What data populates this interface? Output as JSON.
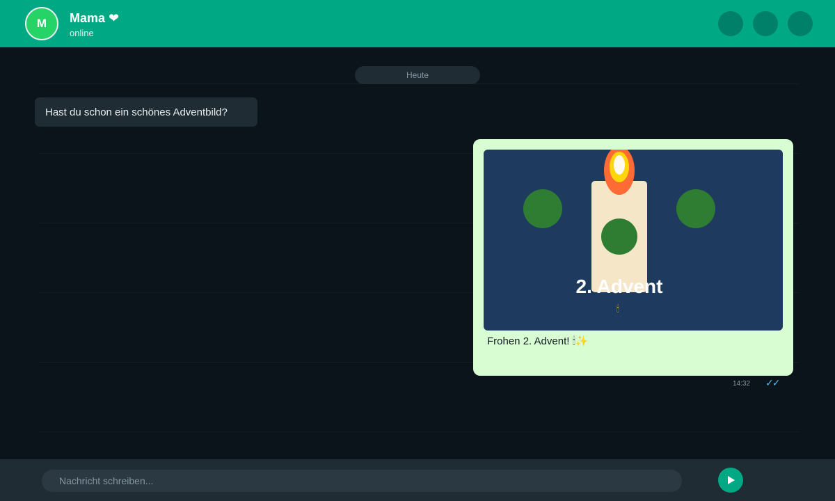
{
  "header": {
    "avatar_initial": "M",
    "contact_name": "Mama ❤",
    "status": "online",
    "action_buttons": [
      "header-action-1",
      "header-action-2",
      "header-action-3"
    ]
  },
  "chat": {
    "date_divider": "Heute",
    "messages": [
      {
        "direction": "incoming",
        "text": "Hast du schon ein schönes Adventbild?"
      },
      {
        "direction": "outgoing",
        "image": {
          "title": "2. Advent",
          "emoji": "🕯",
          "icons": [
            "candle-icon",
            "flame-icon",
            "wreath-ball-icon"
          ]
        },
        "caption": "Frohen 2. Advent! 🕯✨",
        "time": "14:32",
        "status_ticks": "✓✓"
      }
    ]
  },
  "composer": {
    "placeholder": "Nachricht schreiben...",
    "send_icon": "send-icon"
  },
  "colors": {
    "header": "#00a884",
    "chat_background": "#0b141a",
    "incoming_bubble": "#1f2c34",
    "outgoing_bubble": "#d9fdd3",
    "image_background": "#1e3a5f",
    "wreath_green": "#2e7d32",
    "candle": "#f5e6c8",
    "flame_outer": "#ff6b35",
    "flame_middle": "#ffd60a",
    "read_ticks": "#53bdeb"
  }
}
